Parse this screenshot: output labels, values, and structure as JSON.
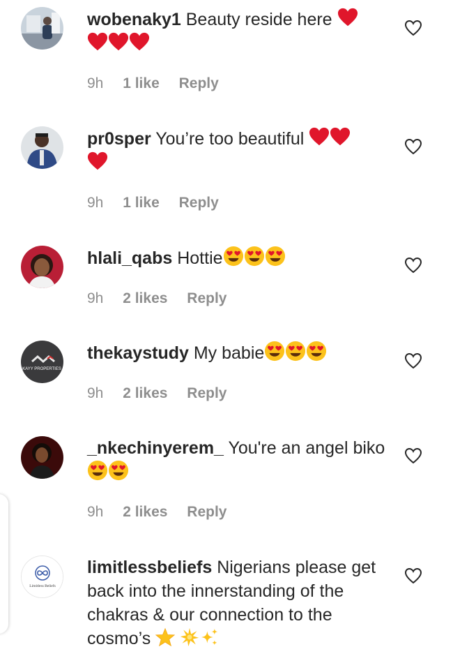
{
  "comments": [
    {
      "username": "wobenaky1",
      "text": "Beauty reside here",
      "emojis": [
        "red-heart",
        "red-heart",
        "red-heart",
        "red-heart"
      ],
      "time": "9h",
      "likes": "1 like",
      "reply": "Reply"
    },
    {
      "username": "pr0sper",
      "text": "You’re too beautiful",
      "emojis": [
        "red-heart",
        "red-heart",
        "red-heart"
      ],
      "time": "9h",
      "likes": "1 like",
      "reply": "Reply"
    },
    {
      "username": "hlali_qabs",
      "text": "Hottie",
      "emojis": [
        "heart-eyes",
        "heart-eyes",
        "heart-eyes"
      ],
      "time": "9h",
      "likes": "2 likes",
      "reply": "Reply"
    },
    {
      "username": "thekaystudy",
      "text": "My babie",
      "emojis": [
        "heart-eyes",
        "heart-eyes",
        "heart-eyes"
      ],
      "time": "9h",
      "likes": "2 likes",
      "reply": "Reply",
      "avatar_text": "KAYY PROPERTIES"
    },
    {
      "username": "_nkechinyerem_",
      "text": "You're an angel biko",
      "emojis": [
        "heart-eyes",
        "heart-eyes"
      ],
      "time": "9h",
      "likes": "2 likes",
      "reply": "Reply"
    },
    {
      "username": "limitlessbeliefs",
      "text": "Nigerians please get back into the innerstanding of the chakras & our connection to the cosmo’s",
      "emojis": [
        "star",
        "glowing-star",
        "sparkles"
      ],
      "avatar_text": "Limitless Beliefs"
    }
  ],
  "icons": {
    "like": "heart-outline-icon"
  },
  "colors": {
    "text": "#262626",
    "meta": "#8e8e8e",
    "heart": "#e0162b"
  }
}
